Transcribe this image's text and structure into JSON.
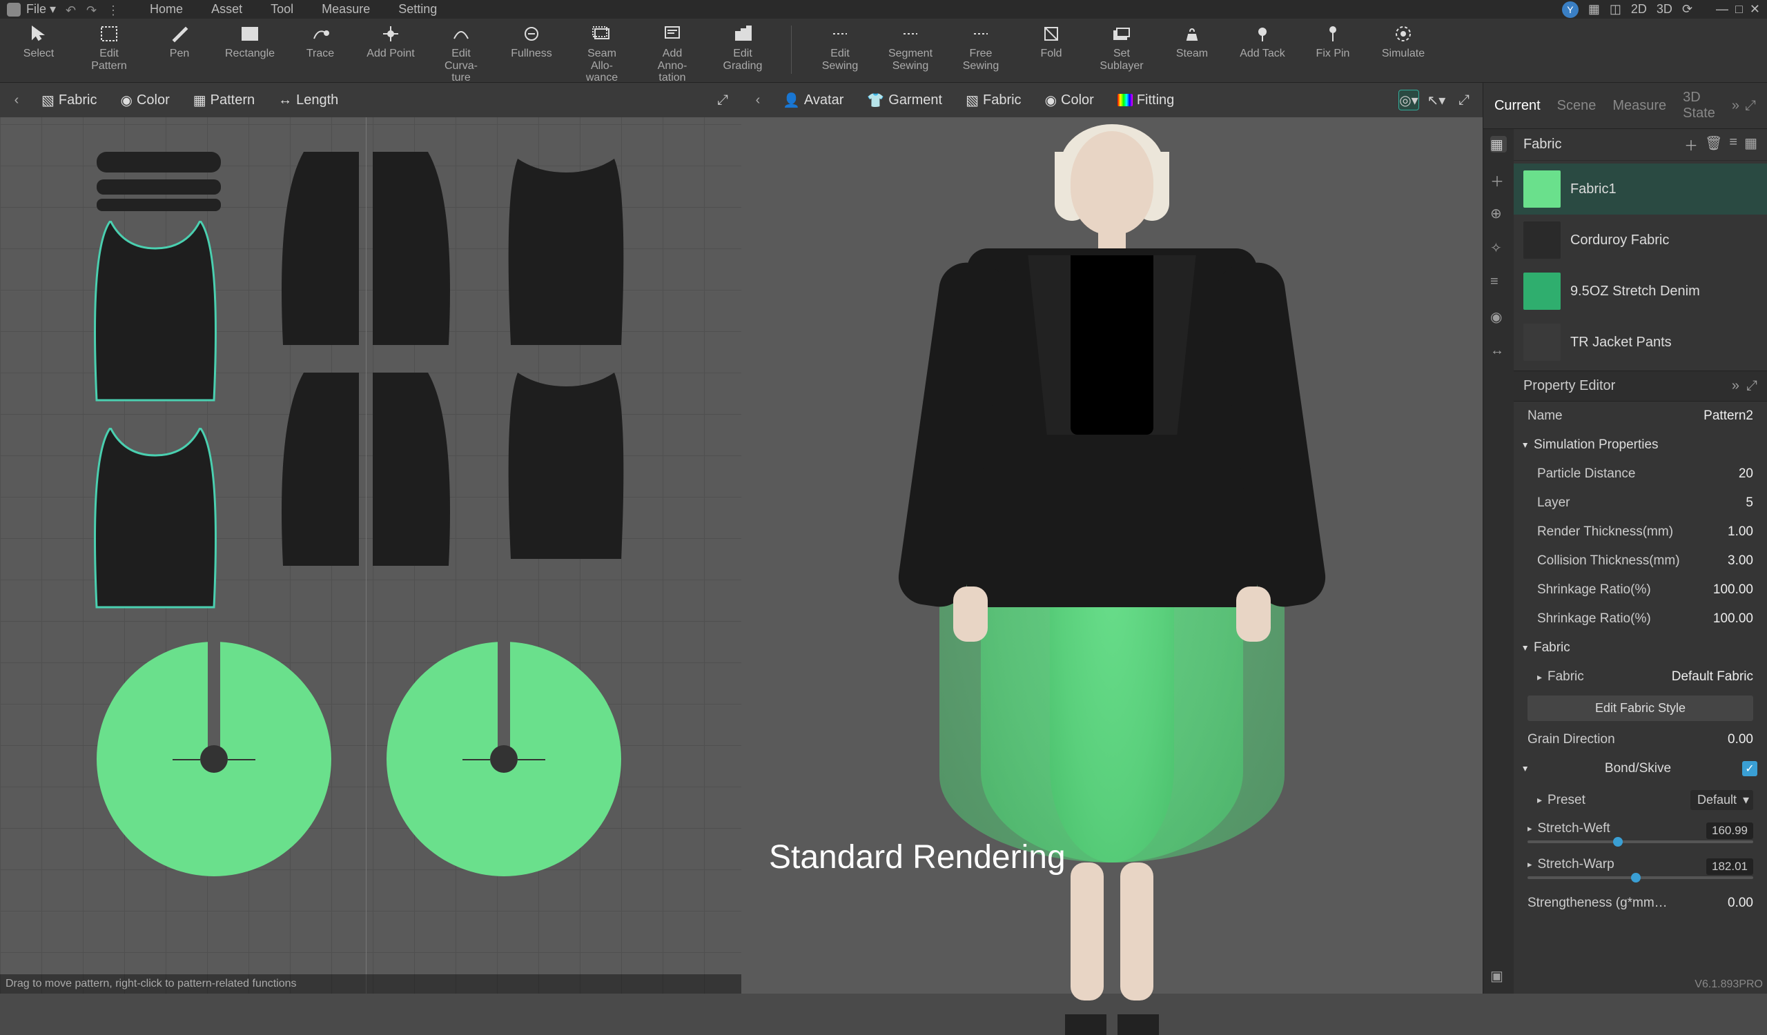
{
  "menubar": {
    "file": "File ▾",
    "items": [
      "Home",
      "Asset",
      "Tool",
      "Measure",
      "Setting"
    ],
    "user_initial": "Y",
    "view_buttons": [
      "2D",
      "3D"
    ]
  },
  "toolbar": [
    {
      "label": "Select"
    },
    {
      "label": "Edit Pattern"
    },
    {
      "label": "Pen"
    },
    {
      "label": "Rectangle"
    },
    {
      "label": "Trace"
    },
    {
      "label": "Add Point"
    },
    {
      "label": "Edit Curva-\nture"
    },
    {
      "label": "Fullness"
    },
    {
      "label": "Seam Allo-\nwance"
    },
    {
      "label": "Add Anno-\ntation"
    },
    {
      "label": "Edit Grading"
    },
    {
      "divider": true
    },
    {
      "label": "Edit Sewing"
    },
    {
      "label": "Segment\nSewing"
    },
    {
      "label": "Free Sewing"
    },
    {
      "label": "Fold"
    },
    {
      "label": "Set Sublayer"
    },
    {
      "label": "Steam"
    },
    {
      "label": "Add Tack"
    },
    {
      "label": "Fix Pin"
    },
    {
      "label": "Simulate"
    }
  ],
  "panel2d": {
    "tabs": [
      "Fabric",
      "Color",
      "Pattern",
      "Length"
    ]
  },
  "panel3d": {
    "tabs": [
      "Avatar",
      "Garment",
      "Fabric",
      "Color",
      "Fitting"
    ],
    "render_label": "Standard Rendering"
  },
  "right": {
    "tabs": [
      "Current",
      "Scene",
      "Measure",
      "3D State"
    ],
    "section_title": "Fabric",
    "fabrics": [
      {
        "name": "Fabric1",
        "color": "#6ae08c",
        "selected": true
      },
      {
        "name": "Corduroy Fabric",
        "color": "#2a2a2a"
      },
      {
        "name": "9.5OZ Stretch Denim",
        "color": "#2fae6e"
      },
      {
        "name": "TR Jacket Pants",
        "color": "#3a3a3a"
      }
    ],
    "property_editor_title": "Property Editor",
    "name_label": "Name",
    "name_value": "Pattern2",
    "sim_group": "Simulation Properties",
    "sim_props": [
      {
        "label": "Particle Distance",
        "value": "20"
      },
      {
        "label": "Layer",
        "value": "5"
      },
      {
        "label": "Render Thickness(mm)",
        "value": "1.00"
      },
      {
        "label": "Collision Thickness(mm)",
        "value": "3.00"
      },
      {
        "label": "Shrinkage Ratio(%)",
        "value": "100.00"
      },
      {
        "label": "Shrinkage Ratio(%)",
        "value": "100.00"
      }
    ],
    "fabric_group": "Fabric",
    "fabric_sub_label": "Fabric",
    "fabric_sub_value": "Default Fabric",
    "edit_fabric_style": "Edit  Fabric Style",
    "grain_label": "Grain Direction",
    "grain_value": "0.00",
    "bond_group": "Bond/Skive",
    "preset_label": "Preset",
    "preset_value": "Default",
    "stretch_weft": {
      "label": "Stretch-Weft",
      "value": "160.99",
      "pct": 38
    },
    "stretch_warp": {
      "label": "Stretch-Warp",
      "value": "182.01",
      "pct": 46
    },
    "strength_label": "Strengtheness  (g*mm…",
    "strength_value": "0.00"
  },
  "statusbar": "Drag to move pattern, right-click to pattern-related functions",
  "version": "V6.1.893PRO"
}
